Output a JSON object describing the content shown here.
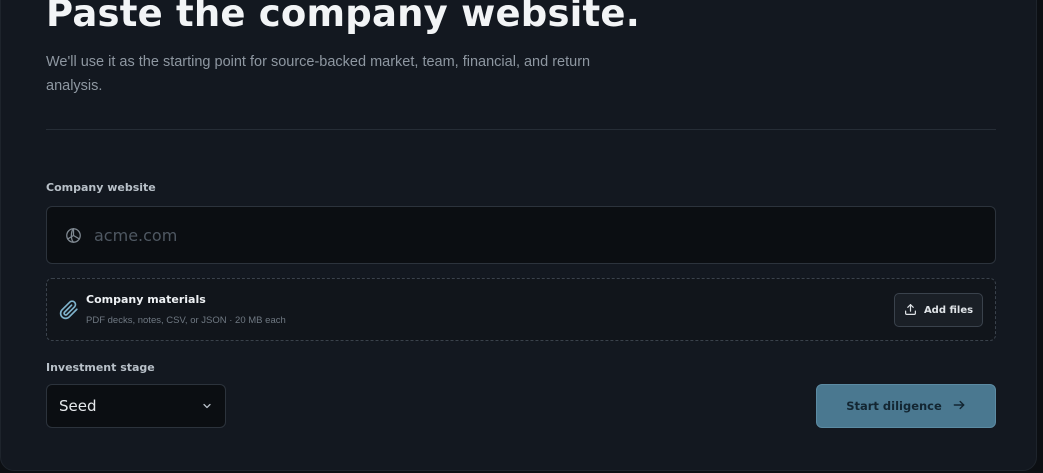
{
  "header": {
    "title": "Paste the company website.",
    "subtitle": "We'll use it as the starting point for source-backed market, team, financial, and return analysis."
  },
  "website": {
    "label": "Company website",
    "placeholder": "acme.com",
    "value": "",
    "icon": "globe-icon"
  },
  "materials": {
    "title": "Company materials",
    "hint": "PDF decks, notes, CSV, or JSON · 20 MB each",
    "icon": "paperclip-icon",
    "add_files_label": "Add files",
    "add_files_icon": "upload-icon"
  },
  "stage": {
    "label": "Investment stage",
    "selected": "Seed",
    "icon": "chevron-down-icon"
  },
  "actions": {
    "start_label": "Start diligence",
    "start_icon": "arrow-right-icon"
  },
  "colors": {
    "background": "#131820",
    "accent": "#4a7890",
    "accent_text": "#132632",
    "text_primary": "#f2f4f6",
    "text_muted": "#8e97a1"
  }
}
